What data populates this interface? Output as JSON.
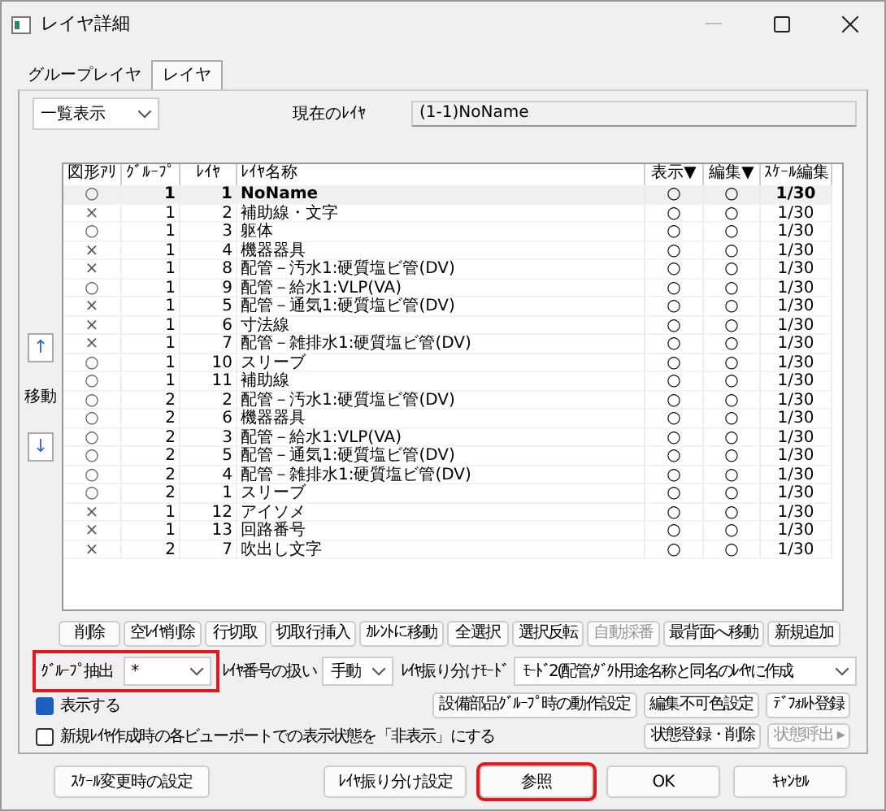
{
  "window": {
    "title": "レイヤ詳細"
  },
  "tabs": [
    {
      "label": "グループレイヤ",
      "selected": false
    },
    {
      "label": "レイヤ",
      "selected": true
    }
  ],
  "view_select": {
    "value": "一覧表示"
  },
  "current_layer": {
    "label": "現在のﾚｲﾔ",
    "value": "(1-1)NoName"
  },
  "move": {
    "up": "↑",
    "label": "移動",
    "down": "↓"
  },
  "table": {
    "columns": [
      "図形ｱﾘ",
      "ｸﾞﾙｰﾌﾟ",
      "ﾚｲﾔ",
      "ﾚｲﾔ名称",
      "表示▼",
      "編集▼",
      "ｽｹｰﾙ編集"
    ],
    "rows": [
      {
        "figure": "○",
        "group": "1",
        "layer": "1",
        "name": "NoName",
        "display": "○",
        "edit": "○",
        "scale": "1/30",
        "current": true
      },
      {
        "figure": "×",
        "group": "1",
        "layer": "2",
        "name": "補助線・文字",
        "display": "○",
        "edit": "○",
        "scale": "1/30",
        "current": false
      },
      {
        "figure": "○",
        "group": "1",
        "layer": "3",
        "name": "躯体",
        "display": "○",
        "edit": "○",
        "scale": "1/30",
        "current": false
      },
      {
        "figure": "×",
        "group": "1",
        "layer": "4",
        "name": "機器器具",
        "display": "○",
        "edit": "○",
        "scale": "1/30",
        "current": false
      },
      {
        "figure": "×",
        "group": "1",
        "layer": "8",
        "name": "配管－汚水1:硬質塩ビ管(DV)",
        "display": "○",
        "edit": "○",
        "scale": "1/30",
        "current": false
      },
      {
        "figure": "○",
        "group": "1",
        "layer": "9",
        "name": "配管－給水1:VLP(VA)",
        "display": "○",
        "edit": "○",
        "scale": "1/30",
        "current": false
      },
      {
        "figure": "×",
        "group": "1",
        "layer": "5",
        "name": "配管－通気1:硬質塩ビ管(DV)",
        "display": "○",
        "edit": "○",
        "scale": "1/30",
        "current": false
      },
      {
        "figure": "×",
        "group": "1",
        "layer": "6",
        "name": "寸法線",
        "display": "○",
        "edit": "○",
        "scale": "1/30",
        "current": false
      },
      {
        "figure": "×",
        "group": "1",
        "layer": "7",
        "name": "配管－雑排水1:硬質塩ビ管(DV)",
        "display": "○",
        "edit": "○",
        "scale": "1/30",
        "current": false
      },
      {
        "figure": "○",
        "group": "1",
        "layer": "10",
        "name": "スリーブ",
        "display": "○",
        "edit": "○",
        "scale": "1/30",
        "current": false
      },
      {
        "figure": "○",
        "group": "1",
        "layer": "11",
        "name": "補助線",
        "display": "○",
        "edit": "○",
        "scale": "1/30",
        "current": false
      },
      {
        "figure": "○",
        "group": "2",
        "layer": "2",
        "name": "配管－汚水1:硬質塩ビ管(DV)",
        "display": "○",
        "edit": "○",
        "scale": "1/30",
        "current": false
      },
      {
        "figure": "○",
        "group": "2",
        "layer": "6",
        "name": "機器器具",
        "display": "○",
        "edit": "○",
        "scale": "1/30",
        "current": false
      },
      {
        "figure": "○",
        "group": "2",
        "layer": "3",
        "name": "配管－給水1:VLP(VA)",
        "display": "○",
        "edit": "○",
        "scale": "1/30",
        "current": false
      },
      {
        "figure": "○",
        "group": "2",
        "layer": "5",
        "name": "配管－通気1:硬質塩ビ管(DV)",
        "display": "○",
        "edit": "○",
        "scale": "1/30",
        "current": false
      },
      {
        "figure": "○",
        "group": "2",
        "layer": "4",
        "name": "配管－雑排水1:硬質塩ビ管(DV)",
        "display": "○",
        "edit": "○",
        "scale": "1/30",
        "current": false
      },
      {
        "figure": "○",
        "group": "2",
        "layer": "1",
        "name": "スリーブ",
        "display": "○",
        "edit": "○",
        "scale": "1/30",
        "current": false
      },
      {
        "figure": "×",
        "group": "1",
        "layer": "12",
        "name": "アイソメ",
        "display": "○",
        "edit": "○",
        "scale": "1/30",
        "current": false
      },
      {
        "figure": "×",
        "group": "1",
        "layer": "13",
        "name": "回路番号",
        "display": "○",
        "edit": "○",
        "scale": "1/30",
        "current": false
      },
      {
        "figure": "×",
        "group": "2",
        "layer": "7",
        "name": "吹出し文字",
        "display": "○",
        "edit": "○",
        "scale": "1/30",
        "current": false
      }
    ]
  },
  "action_buttons": [
    {
      "label": "削除",
      "disabled": false
    },
    {
      "label": "空ﾚｲﾔ削除",
      "disabled": false
    },
    {
      "label": "行切取",
      "disabled": false
    },
    {
      "label": "切取行挿入",
      "disabled": false
    },
    {
      "label": "ｶﾚﾝﾄに移動",
      "disabled": false
    },
    {
      "label": "全選択",
      "disabled": false
    },
    {
      "label": "選択反転",
      "disabled": false
    },
    {
      "label": "自動採番",
      "disabled": true
    },
    {
      "label": "最背面へ移動",
      "disabled": false
    },
    {
      "label": "新規追加",
      "disabled": false
    }
  ],
  "group_extract": {
    "label": "ｸﾞﾙｰﾌﾟ抽出",
    "value": "*",
    "highlighted": true
  },
  "layer_number": {
    "label": "ﾚｲﾔ番号の扱い",
    "value": "手動"
  },
  "sort_mode": {
    "label": "ﾚｲﾔ振り分けﾓｰﾄﾞ",
    "value": "ﾓｰﾄﾞ2(配管,ﾀﾞｸﾄ用途名称と同名のﾚｲﾔに作成"
  },
  "checkboxes": [
    {
      "label": "表示する",
      "checked": true
    },
    {
      "label": "新規ﾚｲﾔ作成時の各ビューポートでの表示状態を「非表示」にする",
      "checked": false
    }
  ],
  "side_buttons": [
    {
      "label": "設備部品ｸﾞﾙｰﾌﾟ時の動作設定",
      "disabled": false
    },
    {
      "label": "編集不可色設定",
      "disabled": false
    },
    {
      "label": "ﾃﾞﾌｫﾙﾄ登録",
      "disabled": false
    },
    {
      "label": "状態登録・削除",
      "disabled": false
    },
    {
      "label": "状態呼出 ▸",
      "disabled": true
    }
  ],
  "footer_buttons": [
    {
      "label": "ｽｹｰﾙ変更時の設定",
      "highlighted": false
    },
    {
      "label": "ﾚｲﾔ振り分け設定",
      "highlighted": false
    },
    {
      "label": "参照",
      "highlighted": true
    },
    {
      "label": "OK",
      "highlighted": false
    },
    {
      "label": "ｷｬﾝｾﾙ",
      "highlighted": false
    }
  ]
}
